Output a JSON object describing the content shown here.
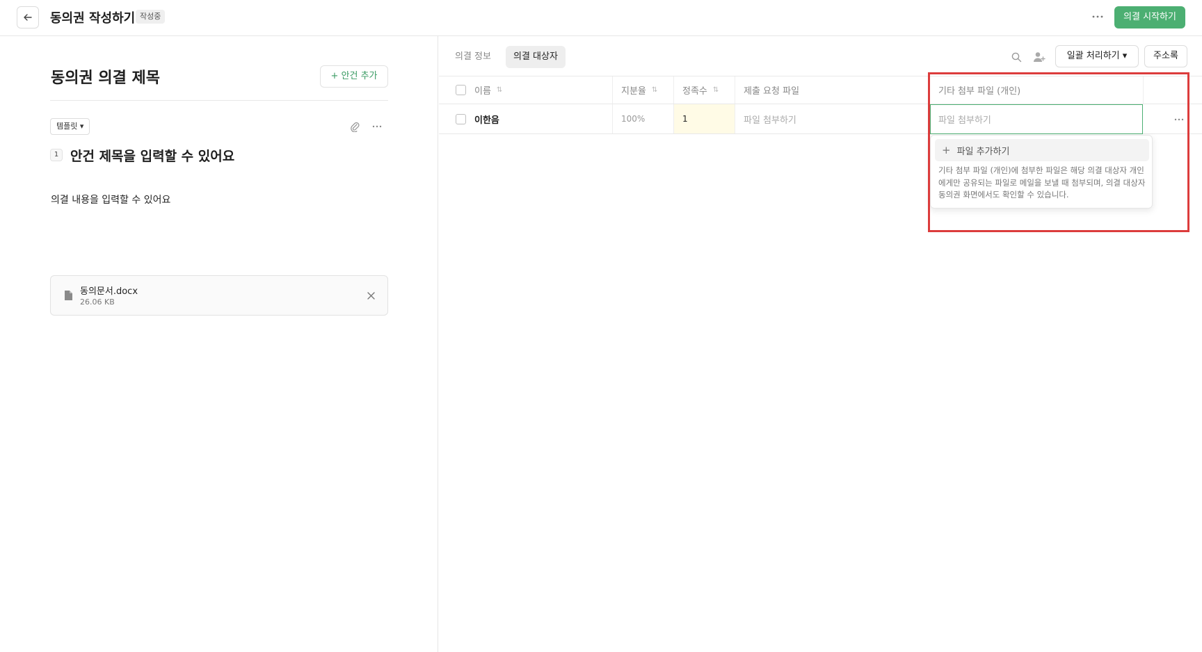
{
  "header": {
    "title": "동의권 작성하기",
    "status_badge": "작성중",
    "start_button": "의결 시작하기"
  },
  "left": {
    "doc_title": "동의권 의결 제목",
    "add_item_button": "+ 안건 추가",
    "template_button": "템플릿 ▾",
    "item_number": "1",
    "item_title": "안건 제목을 입력할 수 있어요",
    "item_content": "의결 내용을 입력할 수 있어요",
    "attachment": {
      "name": "동의문서.docx",
      "size": "26.06 KB"
    }
  },
  "right": {
    "tabs": [
      {
        "label": "의결 정보",
        "active": false
      },
      {
        "label": "의결 대상자",
        "active": true
      }
    ],
    "bulk_button": "일괄 처리하기 ▾",
    "address_button": "주소록",
    "table": {
      "headers": {
        "name": "이름",
        "share": "지분율",
        "count": "정족수",
        "file": "제출 요청 파일",
        "extra": "기타 첨부 파일 (개인)"
      },
      "rows": [
        {
          "name": "이한음",
          "share": "100%",
          "count": "1",
          "file": "파일 첨부하기",
          "extra_placeholder": "파일 첨부하기"
        }
      ]
    },
    "dropdown": {
      "add_label": "파일 추가하기",
      "description": "기타 첨부 파일 (개인)에 첨부한 파일은 해당 의결 대상자 개인에게만 공유되는 파일로 메일을 보낼 때 첨부되며, 의결 대상자 동의권 화면에서도 확인할 수 있습니다."
    }
  },
  "colors": {
    "accent": "#4caf72",
    "highlight": "#dc3c3c",
    "count_bg": "#fffbe6"
  }
}
